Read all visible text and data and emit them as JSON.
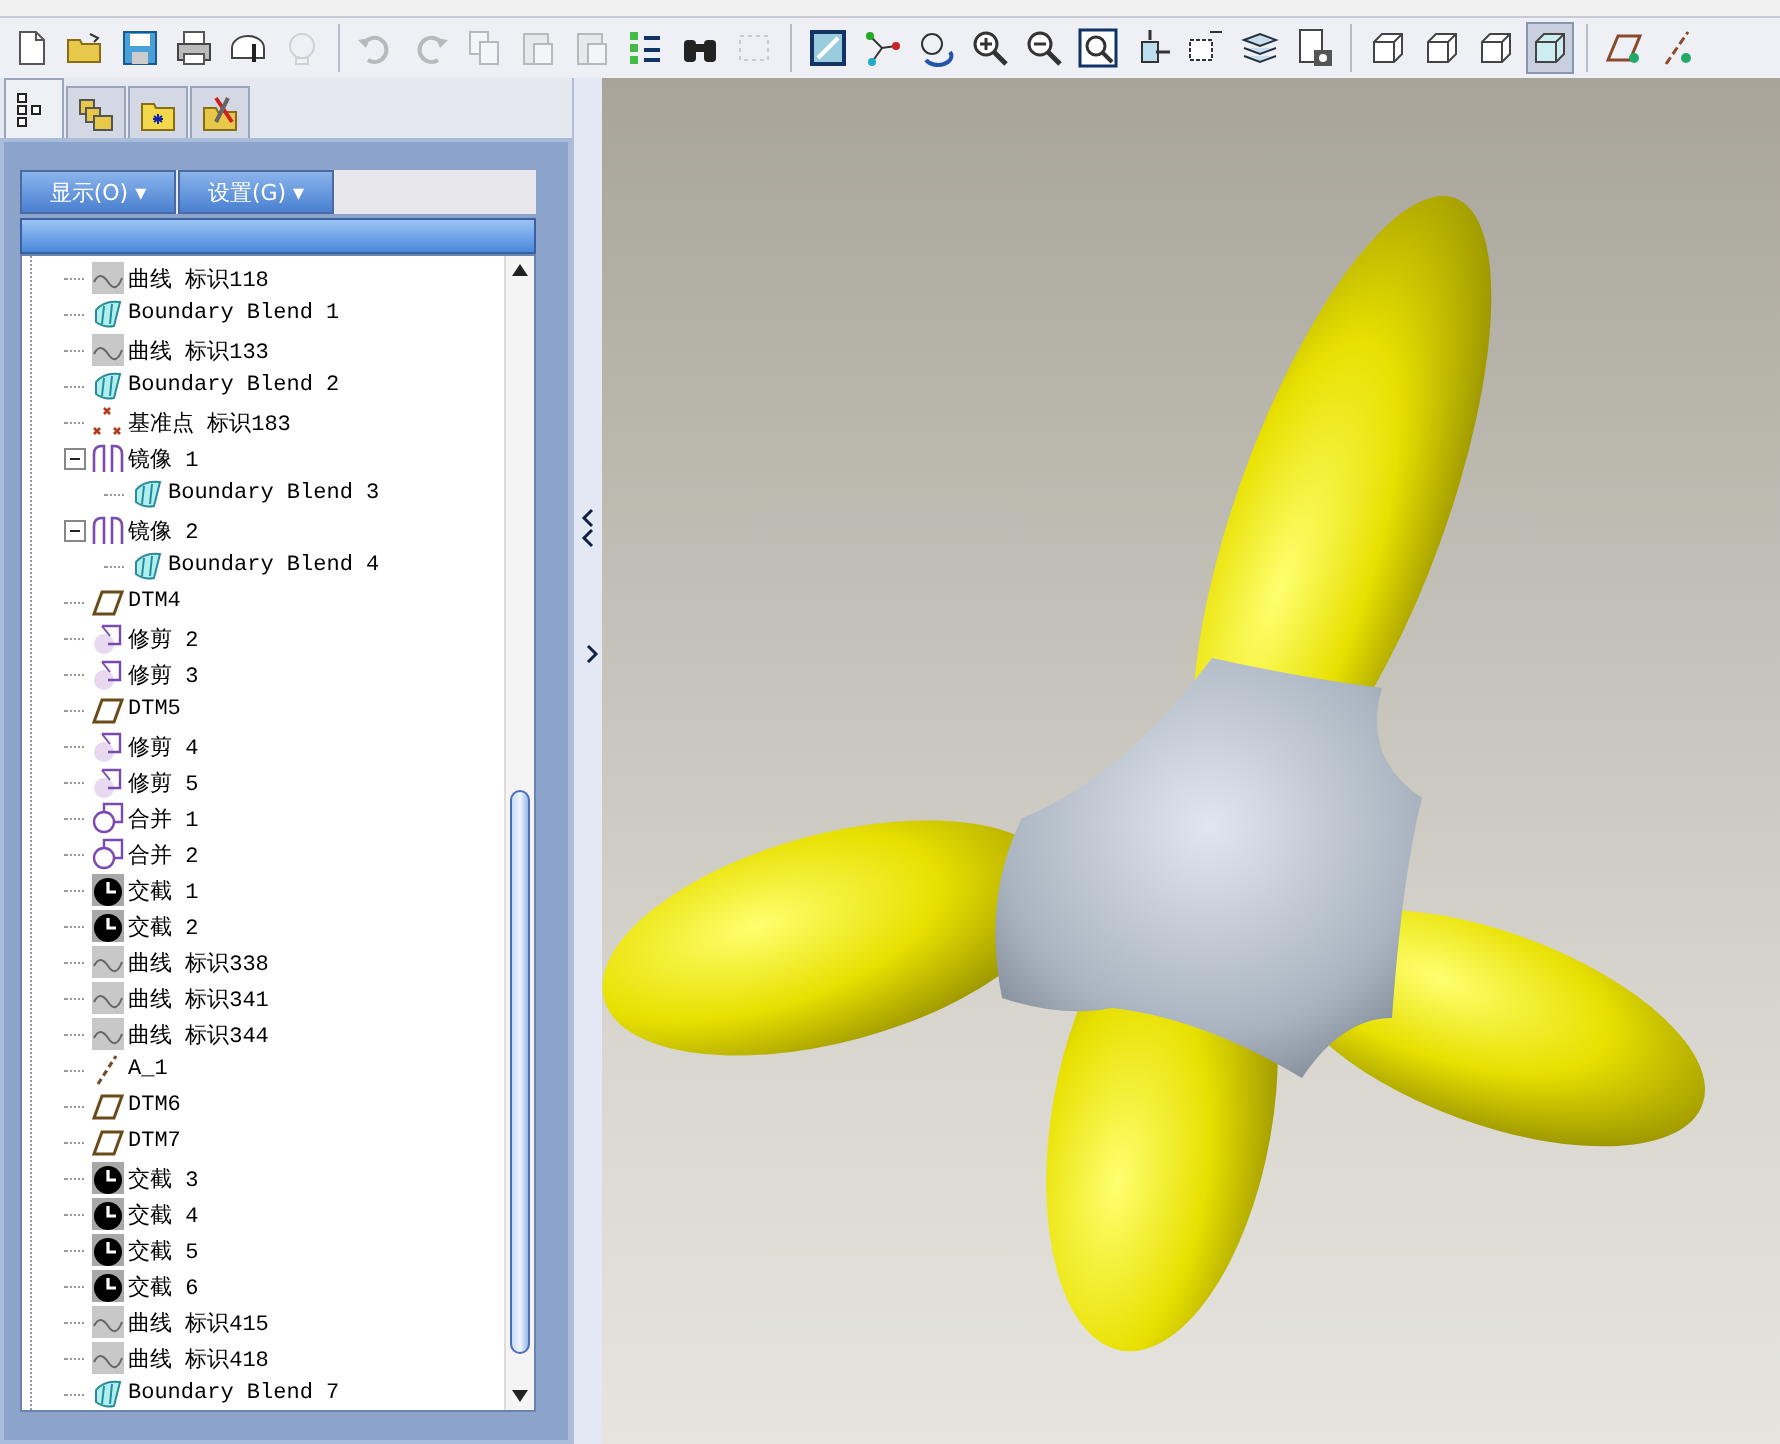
{
  "toolbar": [
    {
      "kind": "new",
      "disabled": false,
      "selected": false
    },
    {
      "kind": "open",
      "disabled": false,
      "selected": false
    },
    {
      "kind": "save",
      "disabled": false,
      "selected": false
    },
    {
      "kind": "print",
      "disabled": false,
      "selected": false
    },
    {
      "kind": "attach",
      "disabled": false,
      "selected": false
    },
    {
      "kind": "session",
      "disabled": true,
      "selected": false
    },
    {
      "kind": "sep"
    },
    {
      "kind": "undo",
      "disabled": true,
      "selected": false
    },
    {
      "kind": "redo",
      "disabled": true,
      "selected": false
    },
    {
      "kind": "copy",
      "disabled": true,
      "selected": false
    },
    {
      "kind": "paste",
      "disabled": true,
      "selected": false
    },
    {
      "kind": "paste",
      "disabled": true,
      "selected": false
    },
    {
      "kind": "regenerate",
      "disabled": false,
      "selected": false
    },
    {
      "kind": "find",
      "disabled": false,
      "selected": false
    },
    {
      "kind": "select",
      "disabled": true,
      "selected": false
    },
    {
      "kind": "sep"
    },
    {
      "kind": "view",
      "disabled": false,
      "selected": false
    },
    {
      "kind": "nodes",
      "disabled": false,
      "selected": false
    },
    {
      "kind": "spin",
      "disabled": false,
      "selected": false
    },
    {
      "kind": "zoomin",
      "disabled": false,
      "selected": false
    },
    {
      "kind": "zoomout",
      "disabled": false,
      "selected": false
    },
    {
      "kind": "refit",
      "disabled": false,
      "selected": false
    },
    {
      "kind": "orient",
      "disabled": false,
      "selected": false
    },
    {
      "kind": "views",
      "disabled": false,
      "selected": false
    },
    {
      "kind": "layers",
      "disabled": false,
      "selected": false
    },
    {
      "kind": "camera",
      "disabled": false,
      "selected": false
    },
    {
      "kind": "sep"
    },
    {
      "kind": "cube",
      "disabled": false,
      "selected": false
    },
    {
      "kind": "cube",
      "disabled": false,
      "selected": false
    },
    {
      "kind": "cube",
      "disabled": false,
      "selected": false
    },
    {
      "kind": "shaded",
      "disabled": false,
      "selected": true
    },
    {
      "kind": "sep"
    },
    {
      "kind": "plane",
      "disabled": false,
      "selected": false
    },
    {
      "kind": "axis",
      "disabled": false,
      "selected": false
    }
  ],
  "panel_tabs": [
    {
      "kind": "tree",
      "selected": true
    },
    {
      "kind": "folders",
      "selected": false
    },
    {
      "kind": "favorites",
      "selected": false
    },
    {
      "kind": "tools",
      "selected": false
    }
  ],
  "panel_buttons": [
    "显示(O) ▾",
    "设置(G) ▾"
  ],
  "tree": {
    "items": [
      {
        "kind": "curve",
        "label": "曲线 标识118"
      },
      {
        "kind": "blend",
        "label": "Boundary Blend 1"
      },
      {
        "kind": "curve",
        "label": "曲线 标识133"
      },
      {
        "kind": "blend",
        "label": "Boundary Blend 2"
      },
      {
        "kind": "point",
        "label": "基准点 标识183"
      },
      {
        "kind": "mirror",
        "label": "镜像 1",
        "expanded": true,
        "children": [
          {
            "kind": "blend",
            "label": "Boundary Blend 3"
          }
        ]
      },
      {
        "kind": "mirror",
        "label": "镜像 2",
        "expanded": true,
        "children": [
          {
            "kind": "blend",
            "label": "Boundary Blend 4"
          }
        ]
      },
      {
        "kind": "datum",
        "label": "DTM4"
      },
      {
        "kind": "trim",
        "label": "修剪 2"
      },
      {
        "kind": "trim",
        "label": "修剪 3"
      },
      {
        "kind": "datum",
        "label": "DTM5"
      },
      {
        "kind": "trim",
        "label": "修剪 4"
      },
      {
        "kind": "trim",
        "label": "修剪 5"
      },
      {
        "kind": "merge",
        "label": "合并 1"
      },
      {
        "kind": "merge",
        "label": "合并 2"
      },
      {
        "kind": "intersect",
        "label": "交截 1"
      },
      {
        "kind": "intersect",
        "label": "交截 2"
      },
      {
        "kind": "curve",
        "label": "曲线 标识338"
      },
      {
        "kind": "curve",
        "label": "曲线 标识341"
      },
      {
        "kind": "curve",
        "label": "曲线 标识344"
      },
      {
        "kind": "axis",
        "label": "A_1"
      },
      {
        "kind": "datum",
        "label": "DTM6"
      },
      {
        "kind": "datum",
        "label": "DTM7"
      },
      {
        "kind": "intersect",
        "label": "交截 3"
      },
      {
        "kind": "intersect",
        "label": "交截 4"
      },
      {
        "kind": "intersect",
        "label": "交截 5"
      },
      {
        "kind": "intersect",
        "label": "交截 6"
      },
      {
        "kind": "curve",
        "label": "曲线 标识415"
      },
      {
        "kind": "curve",
        "label": "曲线 标识418"
      },
      {
        "kind": "blend",
        "label": "Boundary Blend 7"
      }
    ]
  }
}
